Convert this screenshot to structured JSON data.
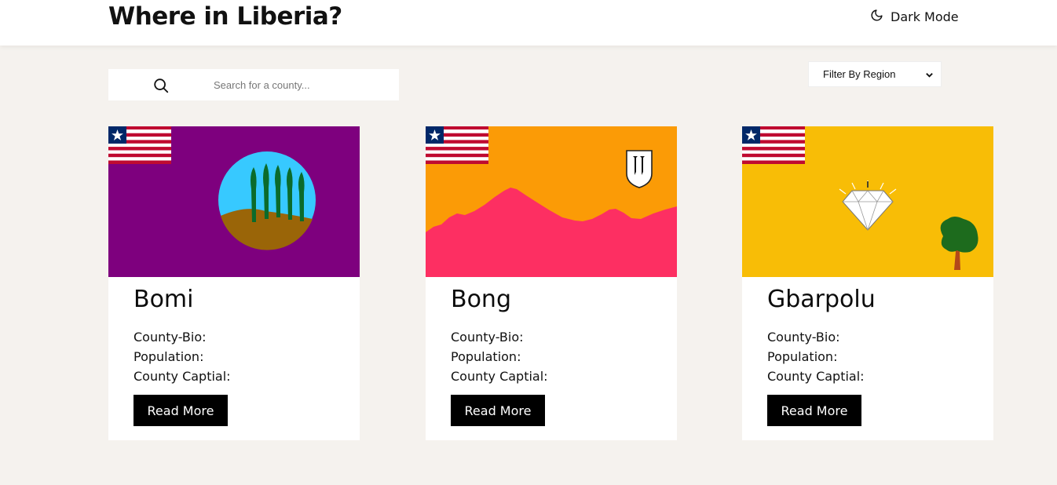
{
  "header": {
    "title": "Where in Liberia?",
    "dark_mode_label": "Dark Mode",
    "dark_mode_icon": "moon-icon"
  },
  "search": {
    "placeholder": "Search for a county...",
    "value": "",
    "icon": "search-icon"
  },
  "filter": {
    "selected": "Filter By Region",
    "icon": "chevron-down-icon"
  },
  "cards": [
    {
      "name": "Bomi",
      "bio_label": "County-Bio:",
      "population_label": "Population:",
      "capital_label": "County Captial:",
      "button": "Read More",
      "flag_bg": "#7e007e"
    },
    {
      "name": "Bong",
      "bio_label": "County-Bio:",
      "population_label": "Population:",
      "capital_label": "County Captial:",
      "button": "Read More",
      "flag_bg": "#fb9b06"
    },
    {
      "name": "Gbarpolu",
      "bio_label": "County-Bio:",
      "population_label": "Population:",
      "capital_label": "County Captial:",
      "button": "Read More",
      "flag_bg": "#f8bd06"
    }
  ],
  "colors": {
    "page_bg": "#f5f2ee",
    "liberia_red": "#bf0a30",
    "liberia_blue": "#002868"
  }
}
